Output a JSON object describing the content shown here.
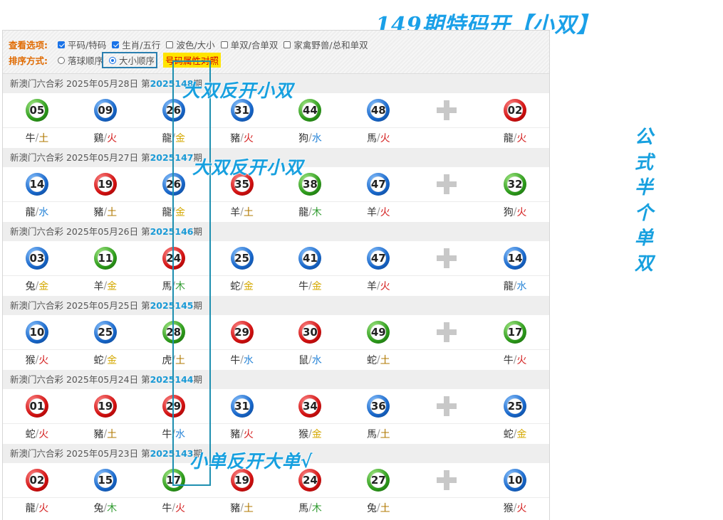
{
  "headline": "149期特码开【小双】",
  "options": {
    "view_label": "查看选项:",
    "view_items": [
      {
        "label": "平码/特码",
        "checked": true
      },
      {
        "label": "生肖/五行",
        "checked": true
      },
      {
        "label": "波色/大小",
        "checked": false
      },
      {
        "label": "单双/合单双",
        "checked": false
      },
      {
        "label": "家禽野兽/总和单双",
        "checked": false
      }
    ],
    "sort_label": "排序方式:",
    "sort_items": [
      {
        "label": "落球顺序",
        "selected": false
      },
      {
        "label": "大小顺序",
        "selected": true
      }
    ],
    "compare_button": "号码属性对照"
  },
  "draws": [
    {
      "prefix": "新澳门六合彩 2025年05月28日 第",
      "period": "2025148",
      "suffix": "期",
      "balls": [
        {
          "num": "05",
          "color": "green",
          "zodiac": "牛",
          "element": "土"
        },
        {
          "num": "09",
          "color": "blue",
          "zodiac": "鷄",
          "element": "火"
        },
        {
          "num": "26",
          "color": "blue",
          "zodiac": "龍",
          "element": "金"
        },
        {
          "num": "31",
          "color": "blue",
          "zodiac": "豬",
          "element": "火"
        },
        {
          "num": "44",
          "color": "green",
          "zodiac": "狗",
          "element": "水"
        },
        {
          "num": "48",
          "color": "blue",
          "zodiac": "馬",
          "element": "火"
        }
      ],
      "special": {
        "num": "02",
        "color": "red",
        "zodiac": "龍",
        "element": "火"
      }
    },
    {
      "prefix": "新澳门六合彩 2025年05月27日 第",
      "period": "2025147",
      "suffix": "期",
      "balls": [
        {
          "num": "14",
          "color": "blue",
          "zodiac": "龍",
          "element": "水"
        },
        {
          "num": "19",
          "color": "red",
          "zodiac": "豬",
          "element": "土"
        },
        {
          "num": "26",
          "color": "blue",
          "zodiac": "龍",
          "element": "金"
        },
        {
          "num": "35",
          "color": "red",
          "zodiac": "羊",
          "element": "土"
        },
        {
          "num": "38",
          "color": "green",
          "zodiac": "龍",
          "element": "木"
        },
        {
          "num": "47",
          "color": "blue",
          "zodiac": "羊",
          "element": "火"
        }
      ],
      "special": {
        "num": "32",
        "color": "green",
        "zodiac": "狗",
        "element": "火"
      }
    },
    {
      "prefix": "新澳门六合彩 2025年05月26日 第",
      "period": "2025146",
      "suffix": "期",
      "balls": [
        {
          "num": "03",
          "color": "blue",
          "zodiac": "兔",
          "element": "金"
        },
        {
          "num": "11",
          "color": "green",
          "zodiac": "羊",
          "element": "金"
        },
        {
          "num": "24",
          "color": "red",
          "zodiac": "馬",
          "element": "木"
        },
        {
          "num": "25",
          "color": "blue",
          "zodiac": "蛇",
          "element": "金"
        },
        {
          "num": "41",
          "color": "blue",
          "zodiac": "牛",
          "element": "金"
        },
        {
          "num": "47",
          "color": "blue",
          "zodiac": "羊",
          "element": "火"
        }
      ],
      "special": {
        "num": "14",
        "color": "blue",
        "zodiac": "龍",
        "element": "水"
      }
    },
    {
      "prefix": "新澳门六合彩 2025年05月25日 第",
      "period": "2025145",
      "suffix": "期",
      "balls": [
        {
          "num": "10",
          "color": "blue",
          "zodiac": "猴",
          "element": "火"
        },
        {
          "num": "25",
          "color": "blue",
          "zodiac": "蛇",
          "element": "金"
        },
        {
          "num": "28",
          "color": "green",
          "zodiac": "虎",
          "element": "土"
        },
        {
          "num": "29",
          "color": "red",
          "zodiac": "牛",
          "element": "水"
        },
        {
          "num": "30",
          "color": "red",
          "zodiac": "鼠",
          "element": "水"
        },
        {
          "num": "49",
          "color": "green",
          "zodiac": "蛇",
          "element": "土"
        }
      ],
      "special": {
        "num": "17",
        "color": "green",
        "zodiac": "牛",
        "element": "火"
      }
    },
    {
      "prefix": "新澳门六合彩 2025年05月24日 第",
      "period": "2025144",
      "suffix": "期",
      "balls": [
        {
          "num": "01",
          "color": "red",
          "zodiac": "蛇",
          "element": "火"
        },
        {
          "num": "19",
          "color": "red",
          "zodiac": "豬",
          "element": "土"
        },
        {
          "num": "29",
          "color": "red",
          "zodiac": "牛",
          "element": "水"
        },
        {
          "num": "31",
          "color": "blue",
          "zodiac": "豬",
          "element": "火"
        },
        {
          "num": "34",
          "color": "red",
          "zodiac": "猴",
          "element": "金"
        },
        {
          "num": "36",
          "color": "blue",
          "zodiac": "馬",
          "element": "土"
        }
      ],
      "special": {
        "num": "25",
        "color": "blue",
        "zodiac": "蛇",
        "element": "金"
      }
    },
    {
      "prefix": "新澳门六合彩 2025年05月23日 第",
      "period": "2025143",
      "suffix": "期",
      "balls": [
        {
          "num": "02",
          "color": "red",
          "zodiac": "龍",
          "element": "火"
        },
        {
          "num": "15",
          "color": "blue",
          "zodiac": "兔",
          "element": "木"
        },
        {
          "num": "17",
          "color": "green",
          "zodiac": "牛",
          "element": "火"
        },
        {
          "num": "19",
          "color": "red",
          "zodiac": "豬",
          "element": "土"
        },
        {
          "num": "24",
          "color": "red",
          "zodiac": "馬",
          "element": "木"
        },
        {
          "num": "27",
          "color": "green",
          "zodiac": "兔",
          "element": "土"
        }
      ],
      "special": {
        "num": "10",
        "color": "blue",
        "zodiac": "猴",
        "element": "火"
      }
    }
  ],
  "element_colors": {
    "金": "#d4a800",
    "木": "#2e9a2e",
    "水": "#2a86d8",
    "火": "#d42020",
    "土": "#b07800"
  },
  "annotations": [
    {
      "text": "大双反开小双"
    },
    {
      "text": "大双反开小双"
    },
    {
      "text": "小单反开大单√"
    }
  ],
  "side_note": [
    "公",
    "式",
    "半",
    "个",
    "单",
    "双"
  ]
}
